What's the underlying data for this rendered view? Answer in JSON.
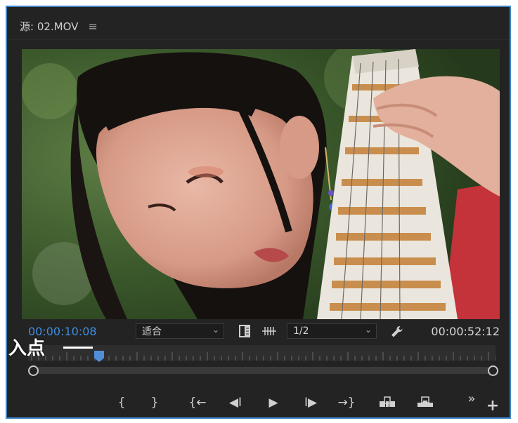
{
  "panel": {
    "title": "源: 02.MOV",
    "menu_icon": "hamburger-menu-icon"
  },
  "viewer": {
    "current_timecode": "00:00:10:08",
    "duration_timecode": "00:00:52:12",
    "zoom": {
      "selected": "适合"
    },
    "resolution": {
      "selected": "1/2"
    }
  },
  "annotation": {
    "in_point_label": "入点"
  },
  "icons": {
    "safe_margins": "safe-margins-icon",
    "drop_frame": "drop-frame-icon",
    "settings": "wrench-icon"
  },
  "transport": {
    "mark_in": "{",
    "mark_out": "}",
    "go_to_in": "{←",
    "step_back": "◀I",
    "play": "▶",
    "step_forward": "I▶",
    "go_to_out": "→}",
    "insert": "insert-icon",
    "overwrite": "overwrite-icon",
    "more": "»",
    "add": "+"
  },
  "colors": {
    "timecode_accent": "#3f8fe0",
    "panel_border": "#3f86c8",
    "playhead": "#4f8fd8"
  }
}
